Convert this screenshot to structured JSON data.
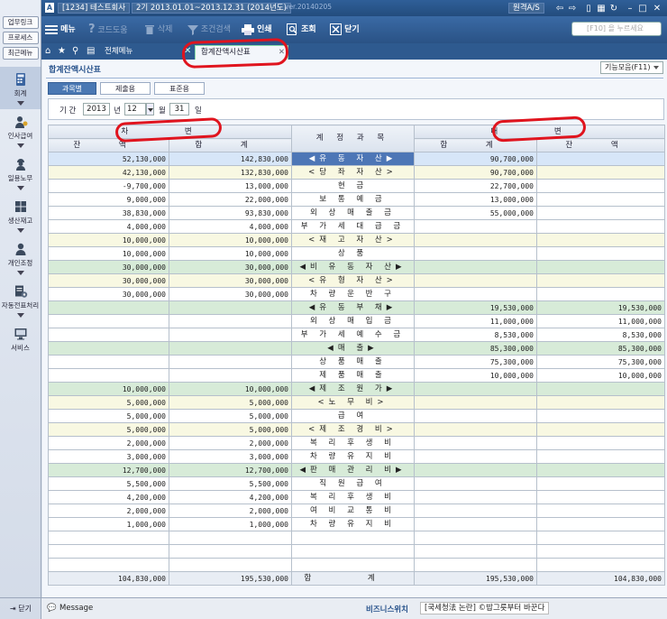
{
  "leftrail": {
    "quick_links": [
      "업무링크",
      "프로세스",
      "최근메뉴"
    ],
    "items": [
      {
        "label": "회계",
        "icon": "calculator-icon"
      },
      {
        "label": "인사급여",
        "icon": "person-money-icon"
      },
      {
        "label": "일용노무",
        "icon": "worker-icon"
      },
      {
        "label": "생산재고",
        "icon": "boxes-icon"
      },
      {
        "label": "개인조정",
        "icon": "person-icon"
      },
      {
        "label": "자동전표처리",
        "icon": "auto-doc-icon"
      },
      {
        "label": "서비스",
        "icon": "monitor-icon"
      }
    ],
    "logout_label": "닫기"
  },
  "titlebar": {
    "company": "[1234] 테스트회사",
    "period": "2기 2013.01.01~2013.12.31 (2014년도)",
    "version": "ver.20140205",
    "remote_label": "원격A/S"
  },
  "toolbar": {
    "menu_label": "메뉴",
    "code_help_label": "코드도움",
    "delete_label": "삭제",
    "condition_label": "조건검색",
    "print_label": "인쇄",
    "search_label": "조회",
    "close_label": "닫기",
    "search_placeholder": "[F10] 을 누르세요"
  },
  "tabs": {
    "all_menu_label": "전체메뉴",
    "active_tab_label": "합계잔액시산표"
  },
  "page": {
    "title": "합계잔액시산표",
    "func_label": "기능모음(F11)",
    "subtabs": [
      "과목별",
      "제출용",
      "표준용"
    ],
    "period_label": "기 간",
    "year": "2013",
    "year_suffix": "년",
    "month": "12",
    "month_suffix": "월",
    "day": "31",
    "day_suffix": "일"
  },
  "grid": {
    "header": {
      "debit": "차 변",
      "account": "계 정 과 목",
      "credit": "대 변",
      "balance": "잔 액",
      "total": "합 계"
    },
    "rows": [
      {
        "dbal": "52,130,000",
        "dtot": "142,830,000",
        "acct": "◀유 동 자 산▶",
        "ctot": "90,700,000",
        "cbal": "",
        "cls": "sel"
      },
      {
        "dbal": "42,130,000",
        "dtot": "132,830,000",
        "acct": "<당 좌 자 산>",
        "ctot": "90,700,000",
        "cbal": "",
        "cls": "lvl2"
      },
      {
        "dbal": "-9,700,000",
        "dtot": "13,000,000",
        "acct": "현 금",
        "ctot": "22,700,000",
        "cbal": "",
        "cls": ""
      },
      {
        "dbal": "9,000,000",
        "dtot": "22,000,000",
        "acct": "보 통 예 금",
        "ctot": "13,000,000",
        "cbal": "",
        "cls": ""
      },
      {
        "dbal": "38,830,000",
        "dtot": "93,830,000",
        "acct": "외 상 매 출 금",
        "ctot": "55,000,000",
        "cbal": "",
        "cls": ""
      },
      {
        "dbal": "4,000,000",
        "dtot": "4,000,000",
        "acct": "부 가 세 대 급 금",
        "ctot": "",
        "cbal": "",
        "cls": ""
      },
      {
        "dbal": "10,000,000",
        "dtot": "10,000,000",
        "acct": "<재 고 자 산>",
        "ctot": "",
        "cbal": "",
        "cls": "lvl2"
      },
      {
        "dbal": "10,000,000",
        "dtot": "10,000,000",
        "acct": "상 품",
        "ctot": "",
        "cbal": "",
        "cls": ""
      },
      {
        "dbal": "30,000,000",
        "dtot": "30,000,000",
        "acct": "◀비 유 동 자 산▶",
        "ctot": "",
        "cbal": "",
        "cls": "lvl1"
      },
      {
        "dbal": "30,000,000",
        "dtot": "30,000,000",
        "acct": "<유 형 자 산>",
        "ctot": "",
        "cbal": "",
        "cls": "lvl2"
      },
      {
        "dbal": "30,000,000",
        "dtot": "30,000,000",
        "acct": "차 량 운 반 구",
        "ctot": "",
        "cbal": "",
        "cls": ""
      },
      {
        "dbal": "",
        "dtot": "",
        "acct": "◀유 동 부 채▶",
        "ctot": "19,530,000",
        "cbal": "19,530,000",
        "cls": "lvl1"
      },
      {
        "dbal": "",
        "dtot": "",
        "acct": "외 상 매 입 금",
        "ctot": "11,000,000",
        "cbal": "11,000,000",
        "cls": ""
      },
      {
        "dbal": "",
        "dtot": "",
        "acct": "부 가 세 예 수 금",
        "ctot": "8,530,000",
        "cbal": "8,530,000",
        "cls": ""
      },
      {
        "dbal": "",
        "dtot": "",
        "acct": "◀매 출▶",
        "ctot": "85,300,000",
        "cbal": "85,300,000",
        "cls": "lvl1"
      },
      {
        "dbal": "",
        "dtot": "",
        "acct": "상 품 매 출",
        "ctot": "75,300,000",
        "cbal": "75,300,000",
        "cls": ""
      },
      {
        "dbal": "",
        "dtot": "",
        "acct": "제 품 매 출",
        "ctot": "10,000,000",
        "cbal": "10,000,000",
        "cls": ""
      },
      {
        "dbal": "10,000,000",
        "dtot": "10,000,000",
        "acct": "◀제 조 원 가▶",
        "ctot": "",
        "cbal": "",
        "cls": "lvl1"
      },
      {
        "dbal": "5,000,000",
        "dtot": "5,000,000",
        "acct": "<노 무 비>",
        "ctot": "",
        "cbal": "",
        "cls": "lvl2"
      },
      {
        "dbal": "5,000,000",
        "dtot": "5,000,000",
        "acct": "급 여",
        "ctot": "",
        "cbal": "",
        "cls": ""
      },
      {
        "dbal": "5,000,000",
        "dtot": "5,000,000",
        "acct": "<제 조 경 비>",
        "ctot": "",
        "cbal": "",
        "cls": "lvl2"
      },
      {
        "dbal": "2,000,000",
        "dtot": "2,000,000",
        "acct": "복 리 후 생 비",
        "ctot": "",
        "cbal": "",
        "cls": ""
      },
      {
        "dbal": "3,000,000",
        "dtot": "3,000,000",
        "acct": "차 량 유 지 비",
        "ctot": "",
        "cbal": "",
        "cls": ""
      },
      {
        "dbal": "12,700,000",
        "dtot": "12,700,000",
        "acct": "◀판 매 관 리 비▶",
        "ctot": "",
        "cbal": "",
        "cls": "lvl1"
      },
      {
        "dbal": "5,500,000",
        "dtot": "5,500,000",
        "acct": "직 원 급 여",
        "ctot": "",
        "cbal": "",
        "cls": ""
      },
      {
        "dbal": "4,200,000",
        "dtot": "4,200,000",
        "acct": "복 리 후 생 비",
        "ctot": "",
        "cbal": "",
        "cls": ""
      },
      {
        "dbal": "2,000,000",
        "dtot": "2,000,000",
        "acct": "여 비 교 통 비",
        "ctot": "",
        "cbal": "",
        "cls": ""
      },
      {
        "dbal": "1,000,000",
        "dtot": "1,000,000",
        "acct": "차 량 유 지 비",
        "ctot": "",
        "cbal": "",
        "cls": ""
      },
      {
        "dbal": "",
        "dtot": "",
        "acct": "",
        "ctot": "",
        "cbal": "",
        "cls": "blank"
      },
      {
        "dbal": "",
        "dtot": "",
        "acct": "",
        "ctot": "",
        "cbal": "",
        "cls": "blank"
      },
      {
        "dbal": "",
        "dtot": "",
        "acct": "",
        "ctot": "",
        "cbal": "",
        "cls": "blank"
      }
    ],
    "total": {
      "dbal": "104,830,000",
      "dtot": "195,530,000",
      "acct": "합 계",
      "ctot": "195,530,000",
      "cbal": "104,830,000"
    }
  },
  "statusbar": {
    "message_label": "Message",
    "biz_label": "비즈니스위치",
    "ticker": "[국세청法 논란] ©밥그릇부터 바꾼다"
  },
  "colors": {
    "title_blue": "#2f5f98",
    "annotation_red": "#e0141e",
    "group_green": "#d7ebd8",
    "subgroup_yellow": "#f8f8e2",
    "selected_blue": "#4d76b6"
  }
}
